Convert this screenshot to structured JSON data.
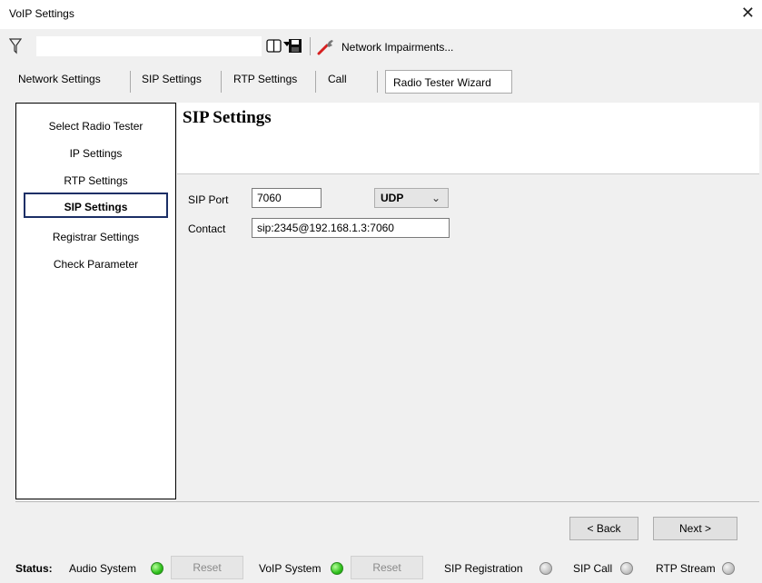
{
  "window": {
    "title": "VoIP Settings",
    "close_glyph": "✕"
  },
  "toolbar": {
    "combo_value": "",
    "impairments_label": "Network Impairments..."
  },
  "tabs": [
    {
      "label": "Network Settings"
    },
    {
      "label": "SIP Settings"
    },
    {
      "label": "RTP Settings"
    },
    {
      "label": "Call"
    },
    {
      "label": "Radio Tester Wizard"
    }
  ],
  "sidebar": {
    "items": [
      {
        "label": "Select Radio Tester"
      },
      {
        "label": "IP Settings"
      },
      {
        "label": "RTP Settings"
      },
      {
        "label": "SIP Settings"
      },
      {
        "label": "Registrar Settings"
      },
      {
        "label": "Check Parameter"
      }
    ],
    "selected": "SIP Settings"
  },
  "main": {
    "title": "SIP Settings",
    "sip_port_label": "SIP Port",
    "sip_port_value": "7060",
    "protocol_value": "UDP",
    "contact_label": "Contact",
    "contact_value": "sip:2345@192.168.1.3:7060"
  },
  "nav": {
    "back_label": "< Back",
    "next_label": "Next >"
  },
  "status": {
    "label": "Status:",
    "audio_system": "Audio System",
    "reset_1": "Reset",
    "voip_system": "VoIP System",
    "reset_2": "Reset",
    "sip_registration": "SIP Registration",
    "sip_call": "SIP Call",
    "rtp_stream": "RTP Stream"
  }
}
